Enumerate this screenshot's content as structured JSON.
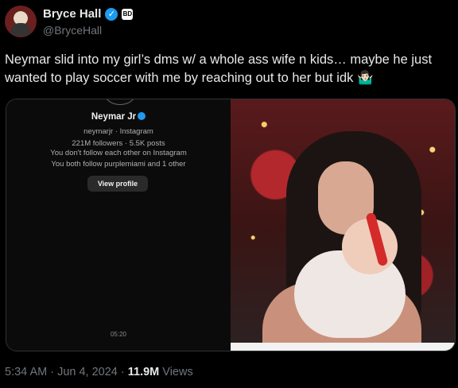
{
  "author": {
    "name": "Bryce Hall",
    "handle": "@BryceHall",
    "badge_text": "BD"
  },
  "tweet": {
    "text": "Neymar slid into my girl’s dms w/ a whole ass wife n kids… maybe he just wanted to play soccer with me by reaching out to her but idk 🤷🏻‍♂️"
  },
  "media_left": {
    "profile_name": "Neymar Jr",
    "line1": "neymarjr · Instagram",
    "line2": "221M followers · 5.5K posts",
    "line3": "You don't follow each other on Instagram",
    "line4": "You both follow purplemiami and 1 other",
    "button": "View profile",
    "time": "05:20"
  },
  "meta": {
    "timestamp": "5:34 AM · Jun 4, 2024 ·",
    "views_count": "11.9M",
    "views_label": "Views"
  }
}
